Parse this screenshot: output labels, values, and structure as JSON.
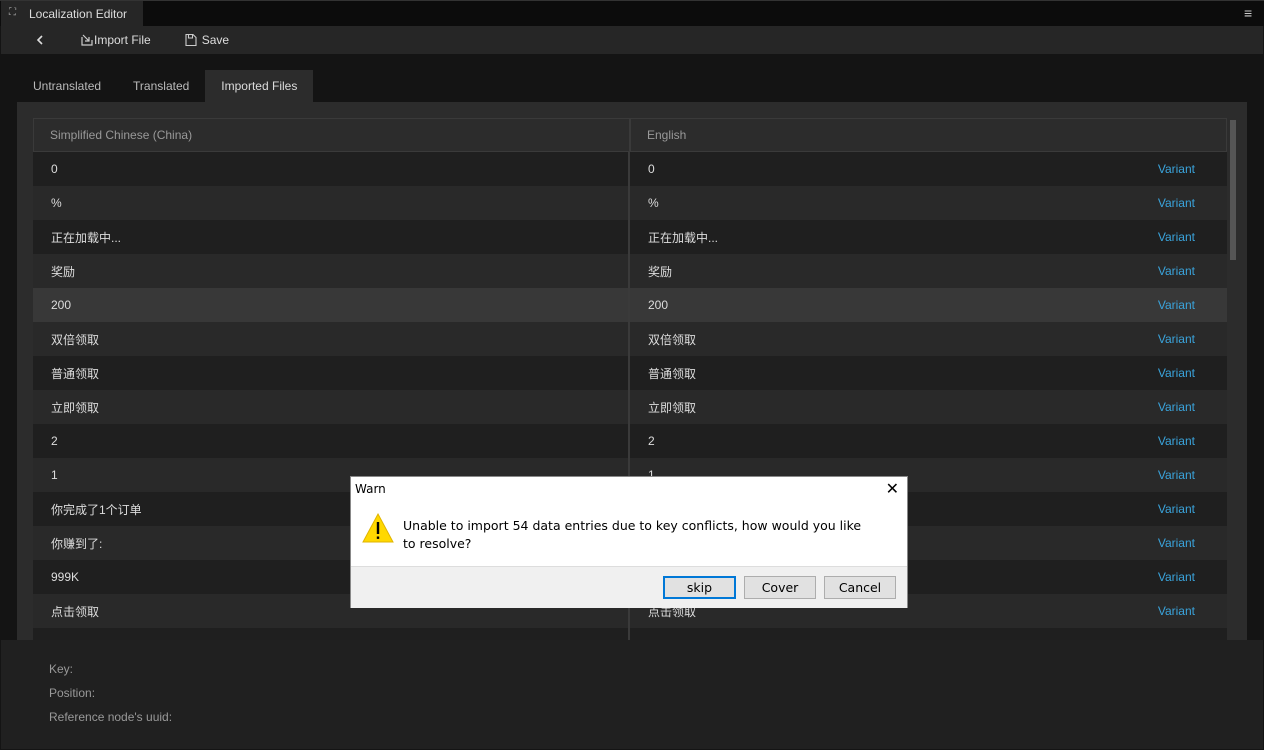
{
  "window": {
    "title": "Localization Editor",
    "menu_icon": "hamburger-icon"
  },
  "toolbar": {
    "back_icon": "chevron-left-icon",
    "import_label": "Import File",
    "save_label": "Save"
  },
  "tabs": [
    {
      "label": "Untranslated"
    },
    {
      "label": "Translated"
    },
    {
      "label": "Imported Files",
      "active": true
    }
  ],
  "table": {
    "columns": [
      "Simplified Chinese (China)",
      "English"
    ],
    "variant_label": "Variant",
    "variant_color": "#3aa4dc",
    "selected_row": 4,
    "rows": [
      [
        "0",
        "0"
      ],
      [
        "%",
        "%"
      ],
      [
        "正在加载中...",
        "正在加载中..."
      ],
      [
        "奖励",
        "奖励"
      ],
      [
        "200",
        "200"
      ],
      [
        "双倍领取",
        "双倍领取"
      ],
      [
        "普通领取",
        "普通领取"
      ],
      [
        "立即领取",
        "立即领取"
      ],
      [
        "2",
        "2"
      ],
      [
        "1",
        "1"
      ],
      [
        "你完成了1个订单",
        ""
      ],
      [
        "你赚到了:",
        ""
      ],
      [
        "999K",
        ""
      ],
      [
        "点击领取",
        "点击领取"
      ],
      [
        "",
        ""
      ]
    ]
  },
  "details": {
    "key_label": "Key:",
    "position_label": "Position:",
    "uuid_label": "Reference node's uuid:"
  },
  "dialog": {
    "title": "Warn",
    "message": "Unable to import 54 data entries due to key conflicts, how would you like to resolve?",
    "icon": "warning-icon",
    "buttons": [
      "skip",
      "Cover",
      "Cancel"
    ]
  }
}
